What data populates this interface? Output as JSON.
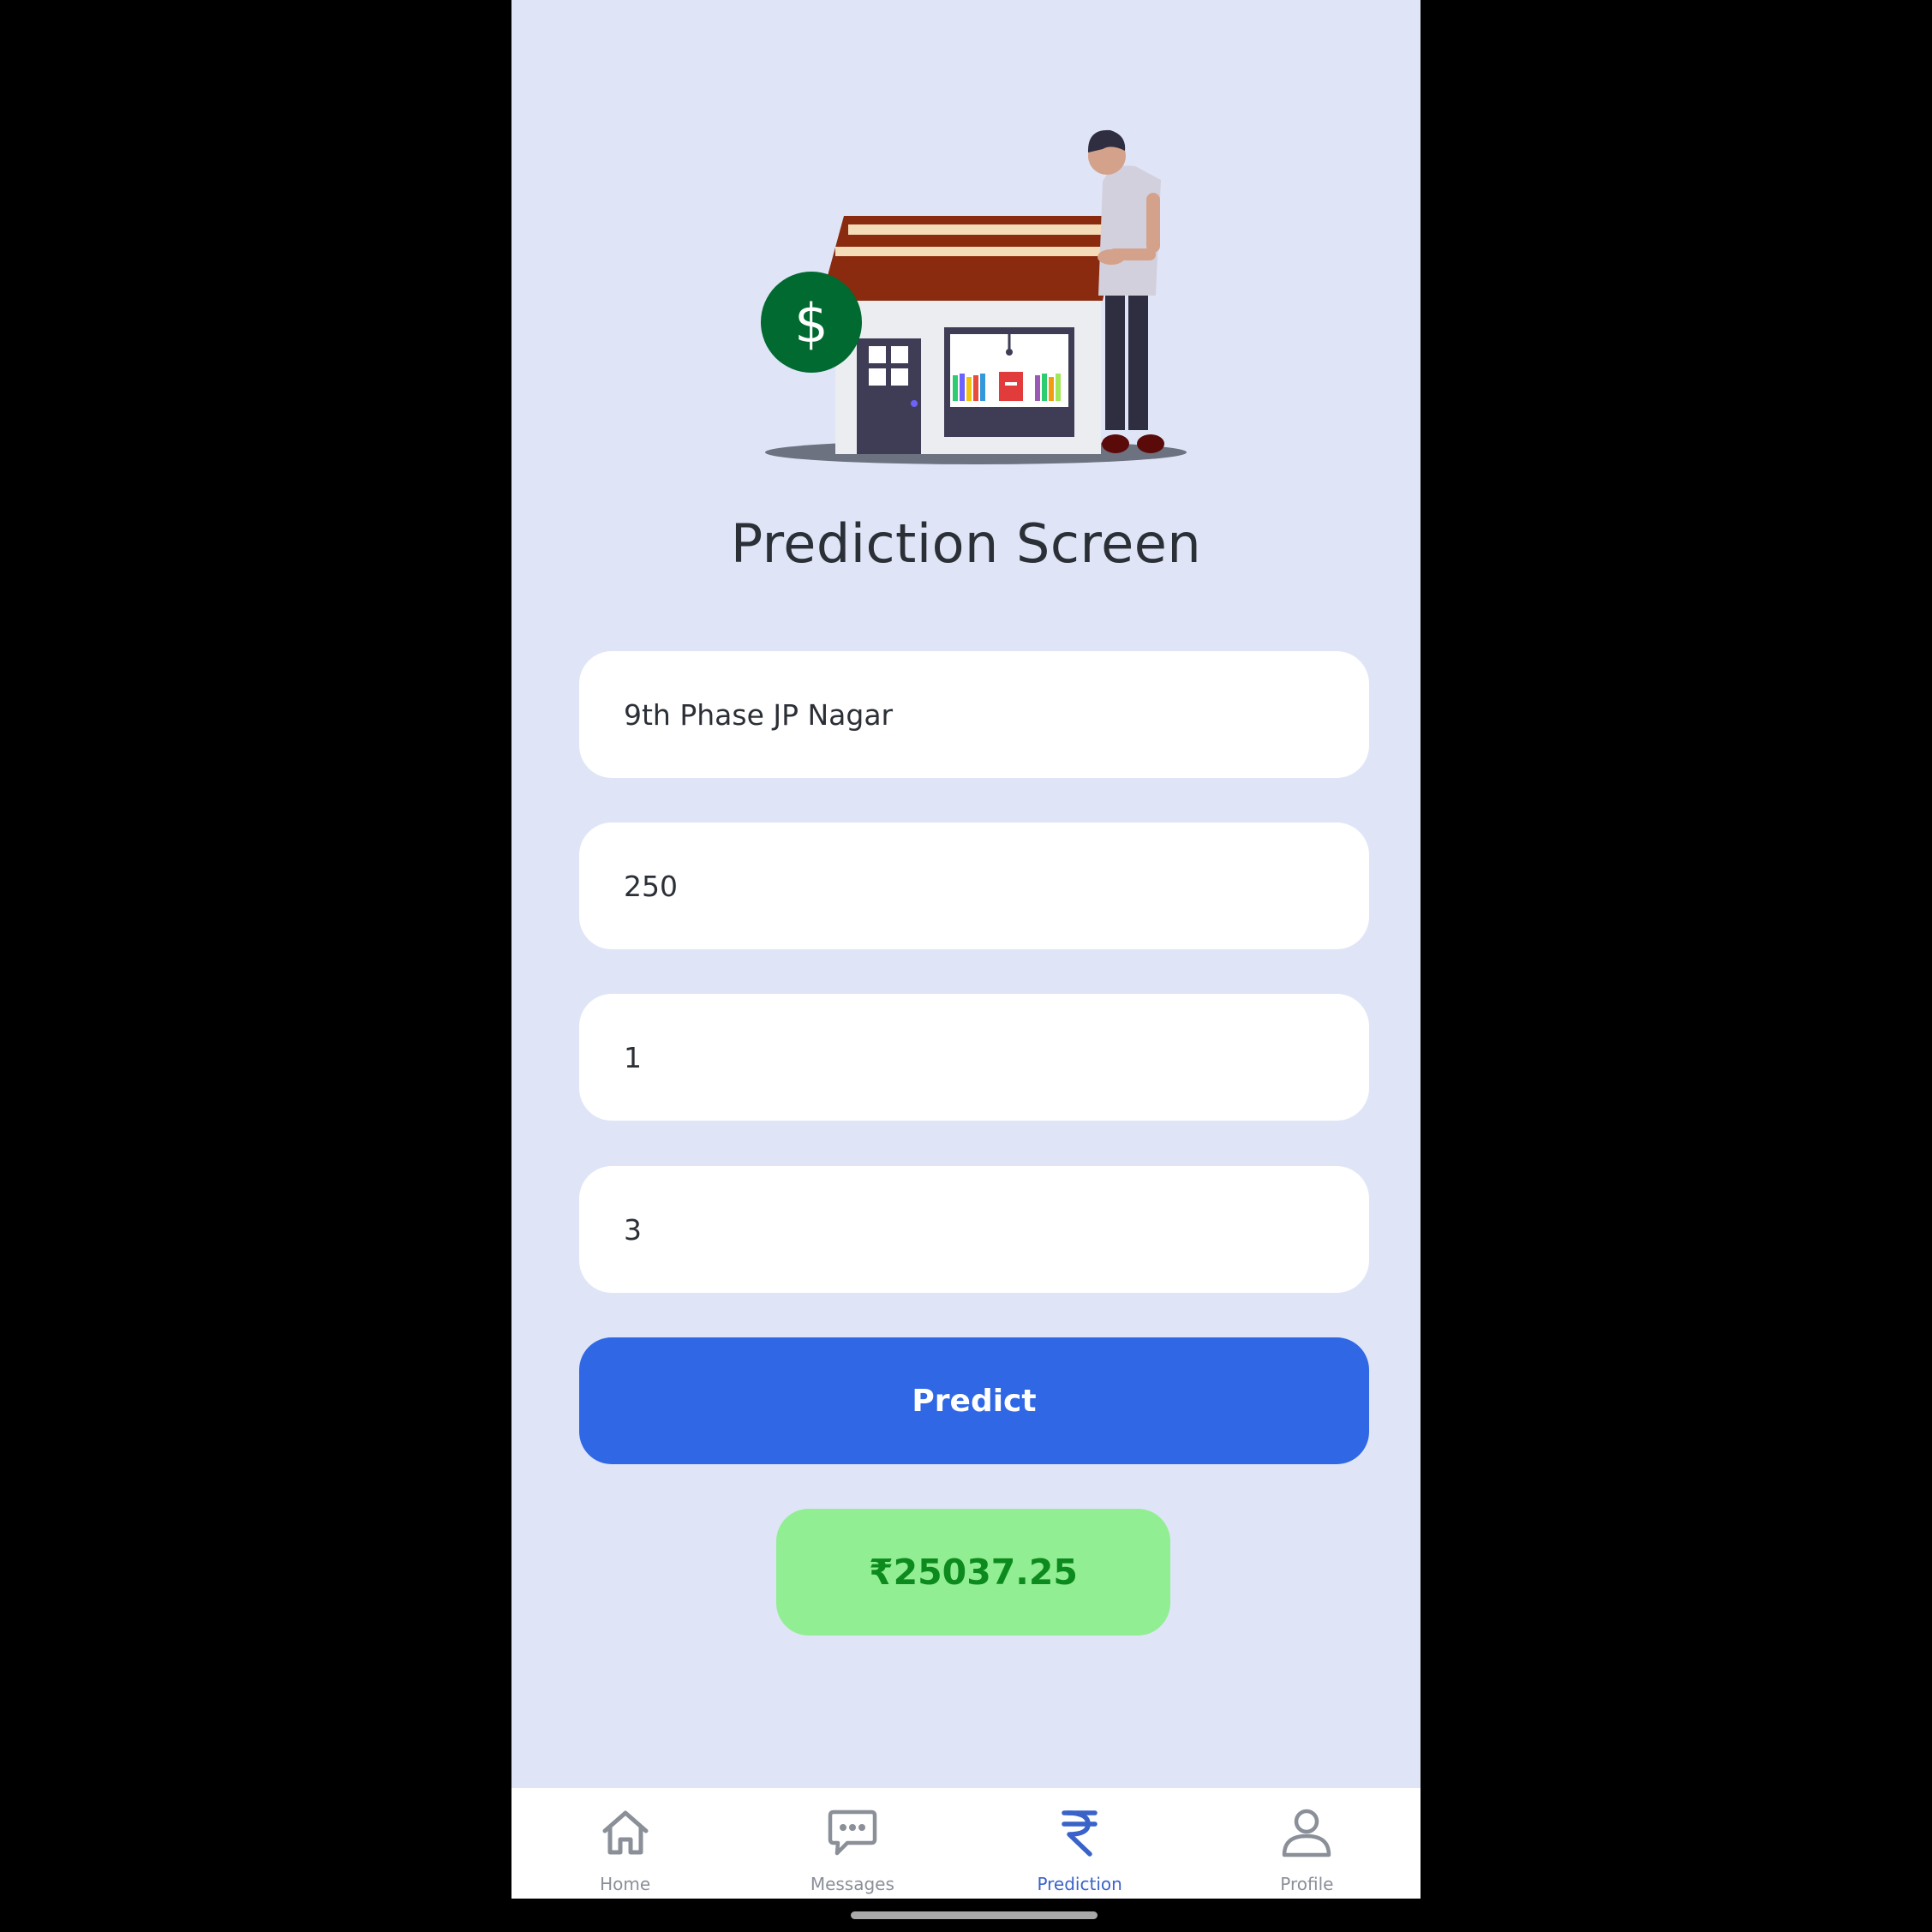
{
  "screen": {
    "title": "Prediction Screen"
  },
  "form": {
    "location": "9th Phase JP Nagar",
    "area": "250",
    "bath": "1",
    "bhk": "3",
    "predict_label": "Predict"
  },
  "result": {
    "price": "₹25037.25"
  },
  "nav": {
    "items": [
      {
        "label": "Home",
        "icon": "home-icon"
      },
      {
        "label": "Messages",
        "icon": "chat-icon"
      },
      {
        "label": "Prediction",
        "icon": "rupee-icon"
      },
      {
        "label": "Profile",
        "icon": "user-icon"
      }
    ],
    "active": "Prediction"
  },
  "colors": {
    "background": "#dfe5f7",
    "accent": "#2f67e4",
    "result_bg": "#92ee93",
    "result_text": "#0d8a1e",
    "active_nav": "#3a63c9",
    "inactive_nav": "#8a8f98"
  }
}
